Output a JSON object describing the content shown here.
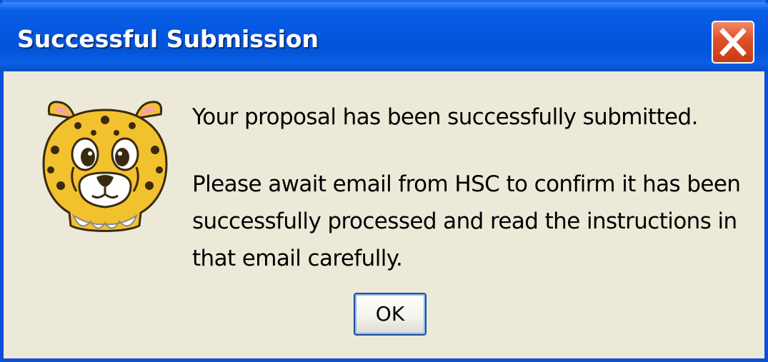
{
  "dialog": {
    "title": "Successful Submission",
    "close_icon": "close-icon",
    "mascot_icon": "cheetah-mascot-icon",
    "message_line1": "Your proposal has been successfully submitted.",
    "message_line2": "Please await email from HSC to confirm it has been successfully processed and read the instructions in that email carefully.",
    "ok_label": "OK"
  },
  "colors": {
    "title_bar": "#0556e0",
    "window_border": "#0a4fd6",
    "background": "#ece9d8",
    "close_button": "#e0522a"
  }
}
